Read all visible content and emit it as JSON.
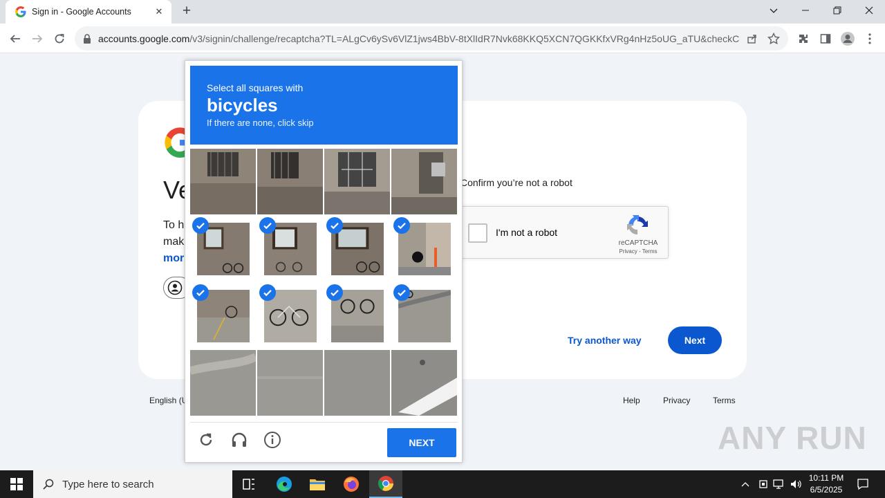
{
  "browser": {
    "tab_title": "Sign in - Google Accounts",
    "url_host": "accounts.google.com",
    "url_path": "/v3/signin/challenge/recaptcha?TL=ALgCv6ySv6VlZ1jws4BbV-8tXlIdR7Nvk68KKQ5XCN7QGKKfxVRg4nHz5oUG_aTU&checkConn..."
  },
  "signin": {
    "heading": "Ve",
    "desc_line1": "To h",
    "desc_line2": "mak",
    "desc_link": "mor",
    "confirm_text": "Confirm you’re not a robot",
    "robot_label": "I'm not a robot",
    "recaptcha_brand": "reCAPTCHA",
    "recaptcha_links": "Privacy - Terms",
    "try_another": "Try another way",
    "next": "Next",
    "footer_lang": "English (U",
    "footer_help": "Help",
    "footer_privacy": "Privacy",
    "footer_terms": "Terms"
  },
  "challenge": {
    "line1": "Select all squares with",
    "word": "bicycles",
    "line3": "If there are none, click skip",
    "next_label": "NEXT",
    "selected": [
      false,
      false,
      false,
      false,
      true,
      true,
      true,
      true,
      true,
      true,
      true,
      true,
      false,
      false,
      false,
      false
    ]
  },
  "watermark": "ANY RUN",
  "taskbar": {
    "search_placeholder": "Type here to search",
    "time": "10:11 PM",
    "date": "6/5/2025"
  },
  "colors": {
    "captcha_blue": "#1a73e8",
    "google_blue": "#0b57d0"
  }
}
